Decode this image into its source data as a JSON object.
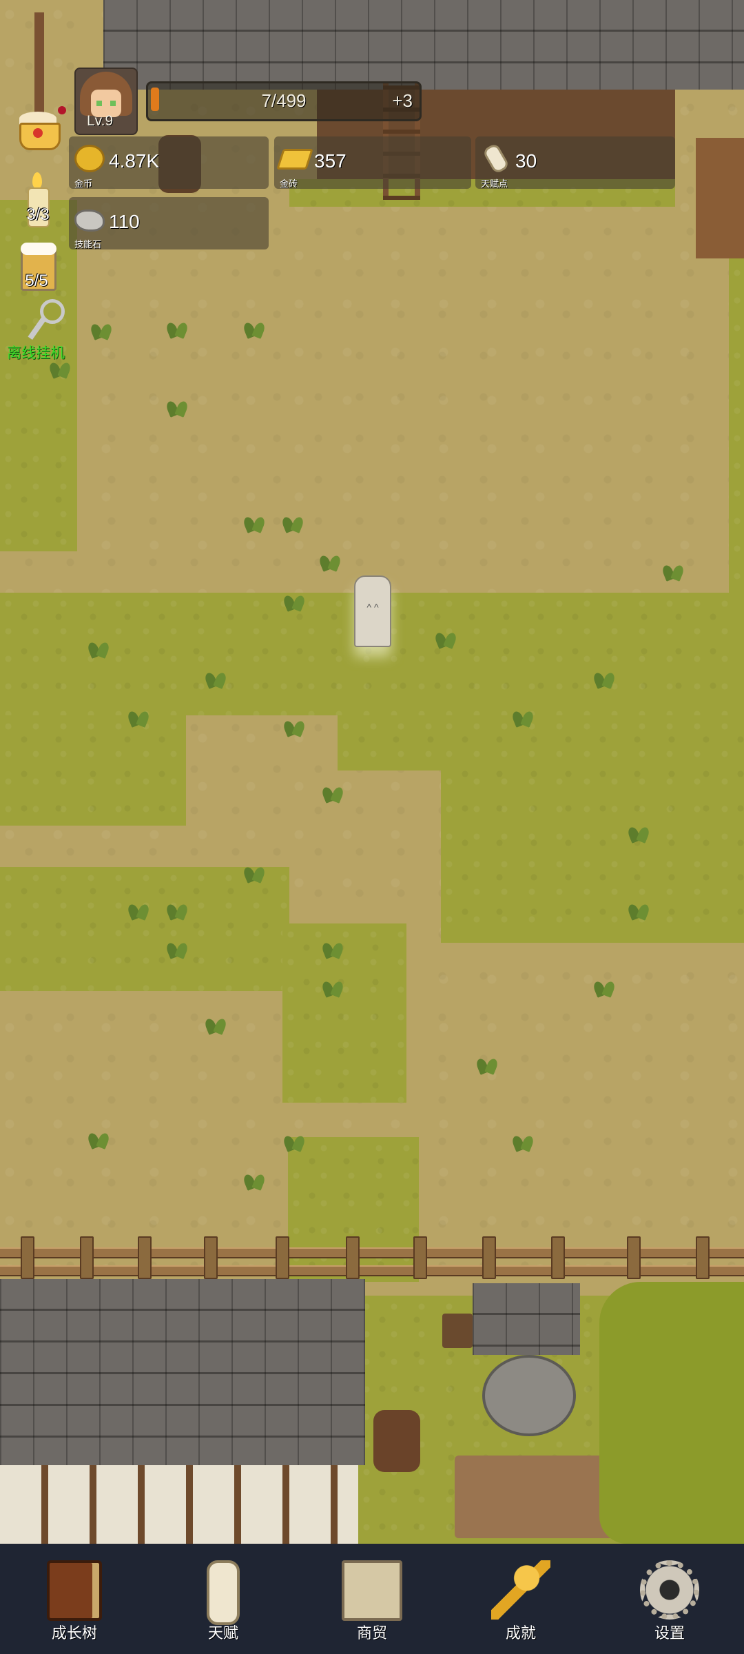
{
  "player": {
    "level_label": "Lv.9",
    "xp_text": "7/499",
    "xp_progress": 0.014,
    "xp_bonus": "+3"
  },
  "resources": [
    {
      "icon": "gold-coin-icon",
      "value": "4.87K",
      "label": "金币"
    },
    {
      "icon": "gold-brick-icon",
      "value": "357",
      "label": "金砖"
    },
    {
      "icon": "talent-scroll-icon",
      "value": "30",
      "label": "天赋点"
    },
    {
      "icon": "skill-stone-icon",
      "value": "110",
      "label": "技能石"
    }
  ],
  "side_items": {
    "candle_count": "3/3",
    "beer_count": "5/5",
    "idle_label": "离线挂机"
  },
  "nav": [
    {
      "icon": "book-icon",
      "label": "成长树"
    },
    {
      "icon": "scroll-icon",
      "label": "天赋"
    },
    {
      "icon": "map-icon",
      "label": "商贸"
    },
    {
      "icon": "gold-key-icon",
      "label": "成就"
    },
    {
      "icon": "gear-icon",
      "label": "设置"
    }
  ],
  "colors": {
    "ground": "#b8a465",
    "grass": "#9ea23a",
    "nav_bg": "#1f2533",
    "xp_fill": "#e07b1c",
    "idle_green": "#39e02a"
  }
}
